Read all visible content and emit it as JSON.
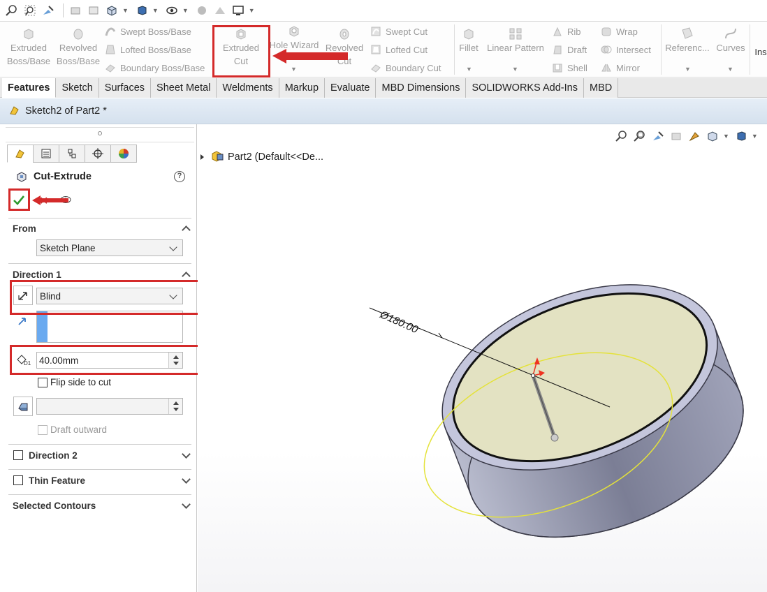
{
  "ribbon": {
    "extruded_boss": "Extruded\nBoss/Base",
    "revolved_boss": "Revolved\nBoss/Base",
    "swept_boss": "Swept Boss/Base",
    "lofted_boss": "Lofted Boss/Base",
    "boundary_boss": "Boundary Boss/Base",
    "extruded_cut_1": "Extruded",
    "extruded_cut_2": "Cut",
    "hole_wizard": "Hole Wizard",
    "revolved_cut_1": "Revolved",
    "revolved_cut_2": "Cut",
    "swept_cut": "Swept Cut",
    "lofted_cut": "Lofted Cut",
    "boundary_cut": "Boundary Cut",
    "fillet": "Fillet",
    "linear_pattern": "Linear Pattern",
    "rib": "Rib",
    "draft": "Draft",
    "shell": "Shell",
    "wrap": "Wrap",
    "intersect": "Intersect",
    "mirror": "Mirror",
    "reference": "Referenc...",
    "curves": "Curves",
    "instant": "Ins"
  },
  "tabs": [
    "Features",
    "Sketch",
    "Surfaces",
    "Sheet Metal",
    "Weldments",
    "Markup",
    "Evaluate",
    "MBD Dimensions",
    "SOLIDWORKS Add-Ins",
    "MBD"
  ],
  "doc": {
    "title": "Sketch2 of Part2 *"
  },
  "pm": {
    "title": "Cut-Extrude",
    "help": "?",
    "from_label": "From",
    "from_value": "Sketch Plane",
    "dir1_label": "Direction 1",
    "end_condition": "Blind",
    "depth": "40.00mm",
    "flip_side": "Flip side to cut",
    "draft_outward": "Draft outward",
    "dir2_label": "Direction 2",
    "thin_label": "Thin Feature",
    "contours_label": "Selected Contours"
  },
  "gfx": {
    "tree_item": "Part2  (Default<<De...",
    "dimension": "Ø180.00"
  },
  "colors": {
    "annotation_red": "#d42a2a",
    "face_fill": "#e3e2c2",
    "body_side": "#8f91a6",
    "rim": "#c4c6dc"
  }
}
